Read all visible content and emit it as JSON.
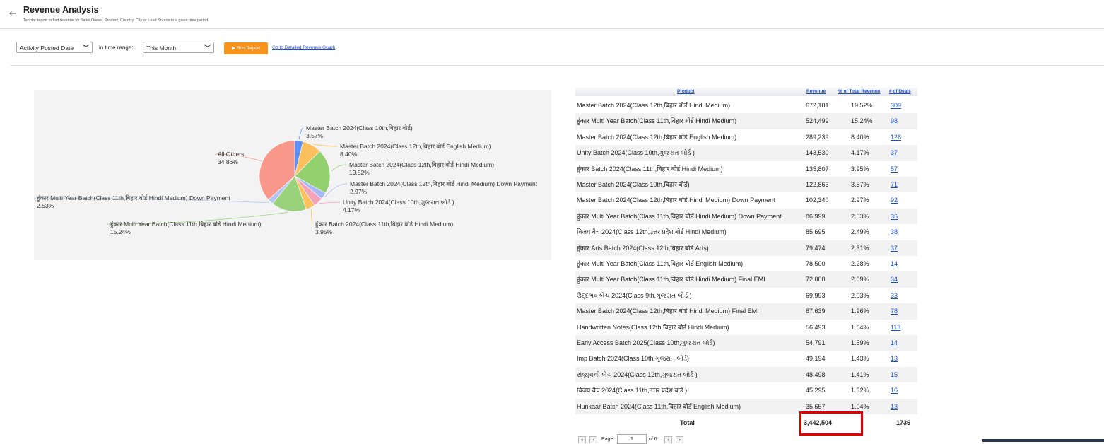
{
  "header": {
    "back_icon": "←",
    "title": "Revenue Analysis",
    "subtitle": "Tabular report to find revenue by Sales Owner, Product, Country, City or Lead Source in a given time period."
  },
  "controls": {
    "date_field": "Activity Posted Date",
    "range_label": "in time range:",
    "range_value": "This Month",
    "run_label": "▶ Run Report",
    "graph_link": "Go to Detailed Revenue Graph"
  },
  "chart_data": {
    "type": "pie",
    "slices": [
      {
        "name": "Master Batch 2024(Class 10th,बिहार बोर्ड)",
        "pct": "3.57%",
        "value": 3.57,
        "color": "#5b8ff9"
      },
      {
        "name": "Master Batch 2024(Class 12th,बिहार बोर्ड English Medium)",
        "pct": "8.40%",
        "value": 8.4,
        "color": "#fcbf5d"
      },
      {
        "name": "Master Batch 2024(Class 12th,बिहार बोर्ड Hindi Medium)",
        "pct": "19.52%",
        "value": 19.52,
        "color": "#93d16f"
      },
      {
        "name": "Master Batch 2024(Class 12th,बिहार बोर्ड Hindi Medium) Down Payment",
        "pct": "2.97%",
        "value": 2.97,
        "color": "#a8b9f5"
      },
      {
        "name": "Unity Batch 2024(Class 10th,ગુજરાત બોર્ડ )",
        "pct": "4.17%",
        "value": 4.17,
        "color": "#f5a3ba"
      },
      {
        "name": "हुंकार Batch 2024(Class 11th,बिहार बोर्ड Hindi Medium)",
        "pct": "3.95%",
        "value": 3.95,
        "color": "#fbc25d"
      },
      {
        "name": "हुंकार Multi Year Batch(Class 11th,बिहार बोर्ड Hindi Medium)",
        "pct": "15.24%",
        "value": 15.24,
        "color": "#99d27a"
      },
      {
        "name": "हुंकार Multi Year Batch(Class 11th,बिहार बोर्ड Hindi Medium) Down Payment",
        "pct": "2.53%",
        "value": 2.53,
        "color": "#b4c6ef"
      },
      {
        "name": "All Others",
        "pct": "34.86%",
        "value": 34.86,
        "color": "#f8978a"
      }
    ]
  },
  "table": {
    "headers": [
      "Product",
      "Revenue",
      "% of Total Revenue",
      "# of Deals"
    ],
    "rows": [
      {
        "product": "Master Batch 2024(Class 12th,बिहार बोर्ड Hindi Medium)",
        "revenue": "672,101",
        "pct": "19.52%",
        "deals": "309"
      },
      {
        "product": "हुंकार Multi Year Batch(Class 11th,बिहार बोर्ड Hindi Medium)",
        "revenue": "524,499",
        "pct": "15.24%",
        "deals": "98"
      },
      {
        "product": "Master Batch 2024(Class 12th,बिहार बोर्ड English Medium)",
        "revenue": "289,239",
        "pct": "8.40%",
        "deals": "126"
      },
      {
        "product": "Unity Batch 2024(Class 10th,ગુજરાત બોર્ડ )",
        "revenue": "143,530",
        "pct": "4.17%",
        "deals": "37"
      },
      {
        "product": "हुंकार Batch 2024(Class 11th,बिहार बोर्ड Hindi Medium)",
        "revenue": "135,807",
        "pct": "3.95%",
        "deals": "57"
      },
      {
        "product": "Master Batch 2024(Class 10th,बिहार बोर्ड)",
        "revenue": "122,863",
        "pct": "3.57%",
        "deals": "71"
      },
      {
        "product": "Master Batch 2024(Class 12th,बिहार बोर्ड Hindi Medium) Down Payment",
        "revenue": "102,340",
        "pct": "2.97%",
        "deals": "92"
      },
      {
        "product": "हुंकार Multi Year Batch(Class 11th,बिहार बोर्ड Hindi Medium) Down Payment",
        "revenue": "86,999",
        "pct": "2.53%",
        "deals": "36"
      },
      {
        "product": "विजय बैच 2024(Class 12th,उत्तर प्रदेश बोर्ड Hindi Medium)",
        "revenue": "85,695",
        "pct": "2.49%",
        "deals": "38"
      },
      {
        "product": "हुंकार Arts Batch 2024(Class 12th,बिहार बोर्ड Arts)",
        "revenue": "79,474",
        "pct": "2.31%",
        "deals": "37"
      },
      {
        "product": "हुंकार Multi Year Batch(Class 11th,बिहार बोर्ड English Medium)",
        "revenue": "78,500",
        "pct": "2.28%",
        "deals": "14"
      },
      {
        "product": "हुंकार Multi Year Batch(Class 11th,बिहार बोर्ड Hindi Medium) Final EMI",
        "revenue": "72,000",
        "pct": "2.09%",
        "deals": "34"
      },
      {
        "product": "ઉદ્દભવ બેચ 2024(Class 9th,ગુજરાત બોર્ડ )",
        "revenue": "69,993",
        "pct": "2.03%",
        "deals": "33"
      },
      {
        "product": "Master Batch 2024(Class 12th,बिहार बोर्ड Hindi Medium) Final EMI",
        "revenue": "67,639",
        "pct": "1.96%",
        "deals": "78"
      },
      {
        "product": "Handwritten Notes(Class 12th,बिहार बोर्ड Hindi Medium)",
        "revenue": "56,493",
        "pct": "1.64%",
        "deals": "113"
      },
      {
        "product": "Early Access Batch 2025(Class 10th,ગુજરાત બોર્ડ)",
        "revenue": "54,791",
        "pct": "1.59%",
        "deals": "14"
      },
      {
        "product": "Imp Batch 2024(Class 10th,ગુજરાત બોર્ડ)",
        "revenue": "49,194",
        "pct": "1.43%",
        "deals": "13"
      },
      {
        "product": "સંજીવની બેચ 2024(Class 12th,ગુજરાત બોર્ડ )",
        "revenue": "48,498",
        "pct": "1.41%",
        "deals": "15"
      },
      {
        "product": "विजय बैच 2024(Class 11th,उत्तर प्रदेश बोर्ड )",
        "revenue": "45,295",
        "pct": "1.32%",
        "deals": "16"
      },
      {
        "product": "Hunkaar Batch 2024(Class 11th,बिहार बोर्ड English Medium)",
        "revenue": "35,657",
        "pct": "1.04%",
        "deals": "13"
      }
    ],
    "total_label": "Total",
    "total_revenue": "3,442,504",
    "total_deals": "1736"
  },
  "pager": {
    "first": "«",
    "prev": "‹",
    "page_label": "Page",
    "page_value": "1",
    "of_label": "of 6",
    "next": "›",
    "last": "»"
  }
}
